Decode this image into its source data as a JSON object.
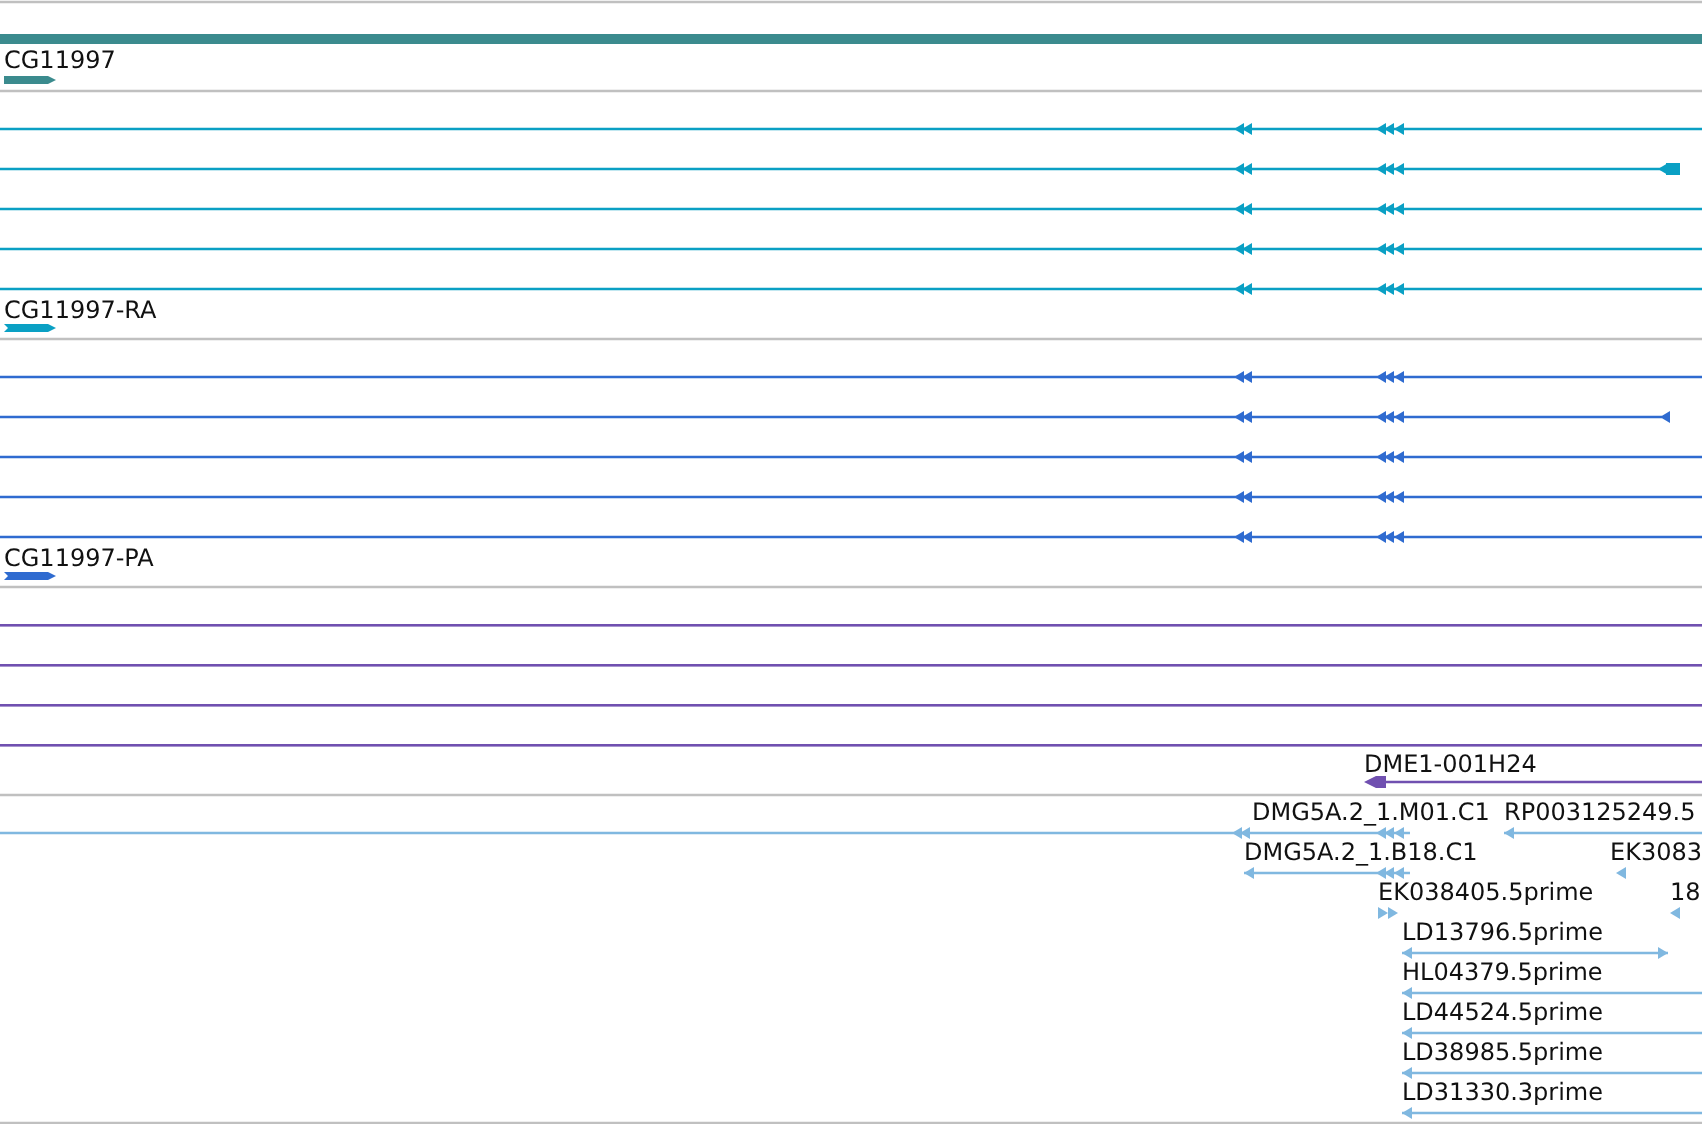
{
  "tracks": [
    {
      "kind": "gene",
      "color": "#3b8b8e",
      "label": "CG11997"
    },
    {
      "kind": "transcripts",
      "color": "#0aa0c4",
      "label": "CG11997-RA",
      "rows": [
        {
          "kind": "plain"
        },
        {
          "kind": "end-block"
        },
        {
          "kind": "plain"
        },
        {
          "kind": "plain"
        },
        {
          "kind": "plain"
        }
      ]
    },
    {
      "kind": "transcripts",
      "color": "#2f6bd0",
      "label": "CG11997-PA",
      "rows": [
        {
          "kind": "plain"
        },
        {
          "kind": "end-arrow"
        },
        {
          "kind": "plain"
        },
        {
          "kind": "plain"
        },
        {
          "kind": "plain"
        }
      ]
    },
    {
      "kind": "clones",
      "color": "#7050b0",
      "rows": [
        {
          "kind": "plain"
        },
        {
          "kind": "plain"
        },
        {
          "kind": "plain"
        },
        {
          "kind": "plain"
        }
      ],
      "features": [
        {
          "label": "DME1-001H24"
        }
      ]
    },
    {
      "kind": "ests",
      "color": "#80b8e0",
      "features": [
        {
          "label": "DMG5A.2_1.M01.C1"
        },
        {
          "label": "RP003125249.5"
        },
        {
          "label": "DMG5A.2_1.B18.C1"
        },
        {
          "label": "EK3083"
        },
        {
          "label": "EK038405.5prime"
        },
        {
          "label": "18"
        },
        {
          "label": "LD13796.5prime"
        },
        {
          "label": "HL04379.5prime"
        },
        {
          "label": "LD44524.5prime"
        },
        {
          "label": "LD38985.5prime"
        },
        {
          "label": "LD31330.3prime"
        }
      ]
    }
  ]
}
